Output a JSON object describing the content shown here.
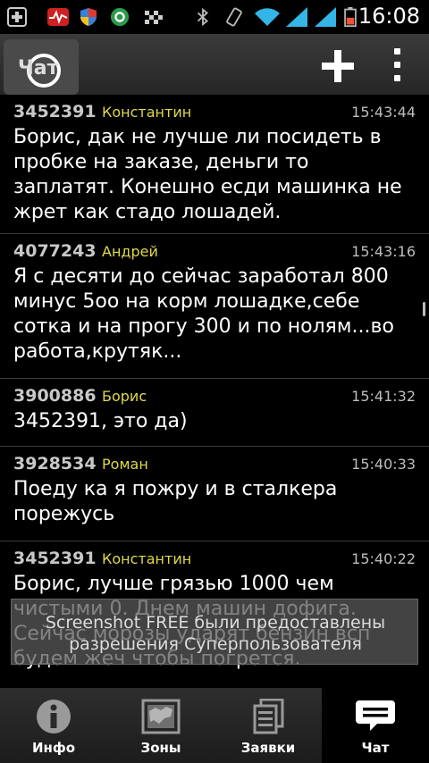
{
  "status_bar": {
    "time": "16:08"
  },
  "action_bar": {
    "title": "Чат"
  },
  "messages": [
    {
      "id": "3452391",
      "name": "Константин",
      "time": "15:43:44",
      "text": "Борис, дак не лучше ли посидеть в пробке на заказе, деньги то заплатят. Конешно есди машинка не жрет как стадо лошадей."
    },
    {
      "id": "4077243",
      "name": "Андрей",
      "time": "15:43:16",
      "text": "Я с десяти до сейчас заработал 800 минус 5оо на корм лошадке,себе сотка и на прогу 300 и по нолям...во работа,крутяк..."
    },
    {
      "id": "3900886",
      "name": "Борис",
      "time": "15:41:32",
      "text": "3452391, это да)"
    },
    {
      "id": "3928534",
      "name": "Роман",
      "time": "15:40:33",
      "text": "Поеду ка я пожру и в сталкера порежусь"
    },
    {
      "id": "3452391",
      "name": "Константин",
      "time": "15:40:22",
      "text": "Борис, лучше грязью 1000 чем чистыми 0. Днем машин дофига. Сейчас морозы ударят бензин всп будем жеч чтобы погрется."
    }
  ],
  "toast": {
    "text": "Screenshot FREE были предоставлены разрешения Суперпользователя"
  },
  "tabs": [
    {
      "label": "Инфо",
      "icon": "info-icon",
      "active": false
    },
    {
      "label": "Зоны",
      "icon": "map-icon",
      "active": false
    },
    {
      "label": "Заявки",
      "icon": "orders-icon",
      "active": false
    },
    {
      "label": "Чат",
      "icon": "chat-icon",
      "active": true
    }
  ]
}
